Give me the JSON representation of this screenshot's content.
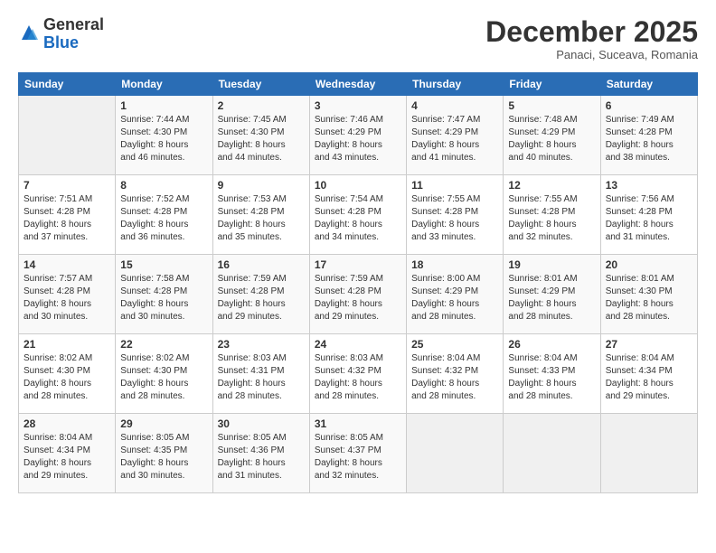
{
  "header": {
    "logo_general": "General",
    "logo_blue": "Blue",
    "month_title": "December 2025",
    "subtitle": "Panaci, Suceava, Romania"
  },
  "days_of_week": [
    "Sunday",
    "Monday",
    "Tuesday",
    "Wednesday",
    "Thursday",
    "Friday",
    "Saturday"
  ],
  "weeks": [
    [
      {
        "day": "",
        "content": ""
      },
      {
        "day": "1",
        "content": "Sunrise: 7:44 AM\nSunset: 4:30 PM\nDaylight: 8 hours\nand 46 minutes."
      },
      {
        "day": "2",
        "content": "Sunrise: 7:45 AM\nSunset: 4:30 PM\nDaylight: 8 hours\nand 44 minutes."
      },
      {
        "day": "3",
        "content": "Sunrise: 7:46 AM\nSunset: 4:29 PM\nDaylight: 8 hours\nand 43 minutes."
      },
      {
        "day": "4",
        "content": "Sunrise: 7:47 AM\nSunset: 4:29 PM\nDaylight: 8 hours\nand 41 minutes."
      },
      {
        "day": "5",
        "content": "Sunrise: 7:48 AM\nSunset: 4:29 PM\nDaylight: 8 hours\nand 40 minutes."
      },
      {
        "day": "6",
        "content": "Sunrise: 7:49 AM\nSunset: 4:28 PM\nDaylight: 8 hours\nand 38 minutes."
      }
    ],
    [
      {
        "day": "7",
        "content": "Sunrise: 7:51 AM\nSunset: 4:28 PM\nDaylight: 8 hours\nand 37 minutes."
      },
      {
        "day": "8",
        "content": "Sunrise: 7:52 AM\nSunset: 4:28 PM\nDaylight: 8 hours\nand 36 minutes."
      },
      {
        "day": "9",
        "content": "Sunrise: 7:53 AM\nSunset: 4:28 PM\nDaylight: 8 hours\nand 35 minutes."
      },
      {
        "day": "10",
        "content": "Sunrise: 7:54 AM\nSunset: 4:28 PM\nDaylight: 8 hours\nand 34 minutes."
      },
      {
        "day": "11",
        "content": "Sunrise: 7:55 AM\nSunset: 4:28 PM\nDaylight: 8 hours\nand 33 minutes."
      },
      {
        "day": "12",
        "content": "Sunrise: 7:55 AM\nSunset: 4:28 PM\nDaylight: 8 hours\nand 32 minutes."
      },
      {
        "day": "13",
        "content": "Sunrise: 7:56 AM\nSunset: 4:28 PM\nDaylight: 8 hours\nand 31 minutes."
      }
    ],
    [
      {
        "day": "14",
        "content": "Sunrise: 7:57 AM\nSunset: 4:28 PM\nDaylight: 8 hours\nand 30 minutes."
      },
      {
        "day": "15",
        "content": "Sunrise: 7:58 AM\nSunset: 4:28 PM\nDaylight: 8 hours\nand 30 minutes."
      },
      {
        "day": "16",
        "content": "Sunrise: 7:59 AM\nSunset: 4:28 PM\nDaylight: 8 hours\nand 29 minutes."
      },
      {
        "day": "17",
        "content": "Sunrise: 7:59 AM\nSunset: 4:28 PM\nDaylight: 8 hours\nand 29 minutes."
      },
      {
        "day": "18",
        "content": "Sunrise: 8:00 AM\nSunset: 4:29 PM\nDaylight: 8 hours\nand 28 minutes."
      },
      {
        "day": "19",
        "content": "Sunrise: 8:01 AM\nSunset: 4:29 PM\nDaylight: 8 hours\nand 28 minutes."
      },
      {
        "day": "20",
        "content": "Sunrise: 8:01 AM\nSunset: 4:30 PM\nDaylight: 8 hours\nand 28 minutes."
      }
    ],
    [
      {
        "day": "21",
        "content": "Sunrise: 8:02 AM\nSunset: 4:30 PM\nDaylight: 8 hours\nand 28 minutes."
      },
      {
        "day": "22",
        "content": "Sunrise: 8:02 AM\nSunset: 4:30 PM\nDaylight: 8 hours\nand 28 minutes."
      },
      {
        "day": "23",
        "content": "Sunrise: 8:03 AM\nSunset: 4:31 PM\nDaylight: 8 hours\nand 28 minutes."
      },
      {
        "day": "24",
        "content": "Sunrise: 8:03 AM\nSunset: 4:32 PM\nDaylight: 8 hours\nand 28 minutes."
      },
      {
        "day": "25",
        "content": "Sunrise: 8:04 AM\nSunset: 4:32 PM\nDaylight: 8 hours\nand 28 minutes."
      },
      {
        "day": "26",
        "content": "Sunrise: 8:04 AM\nSunset: 4:33 PM\nDaylight: 8 hours\nand 28 minutes."
      },
      {
        "day": "27",
        "content": "Sunrise: 8:04 AM\nSunset: 4:34 PM\nDaylight: 8 hours\nand 29 minutes."
      }
    ],
    [
      {
        "day": "28",
        "content": "Sunrise: 8:04 AM\nSunset: 4:34 PM\nDaylight: 8 hours\nand 29 minutes."
      },
      {
        "day": "29",
        "content": "Sunrise: 8:05 AM\nSunset: 4:35 PM\nDaylight: 8 hours\nand 30 minutes."
      },
      {
        "day": "30",
        "content": "Sunrise: 8:05 AM\nSunset: 4:36 PM\nDaylight: 8 hours\nand 31 minutes."
      },
      {
        "day": "31",
        "content": "Sunrise: 8:05 AM\nSunset: 4:37 PM\nDaylight: 8 hours\nand 32 minutes."
      },
      {
        "day": "",
        "content": ""
      },
      {
        "day": "",
        "content": ""
      },
      {
        "day": "",
        "content": ""
      }
    ]
  ]
}
